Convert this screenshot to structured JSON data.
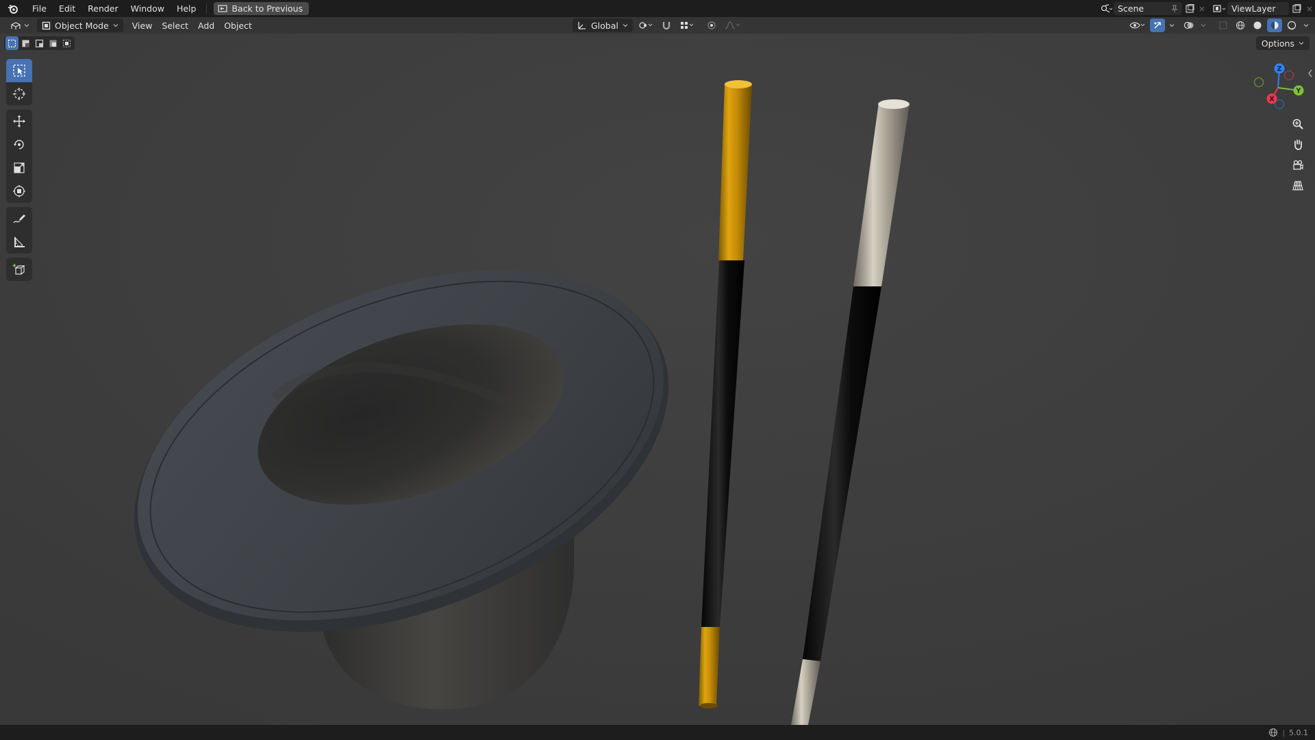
{
  "topbar": {
    "menus": [
      "File",
      "Edit",
      "Render",
      "Window",
      "Help"
    ],
    "back_button": "Back to Previous",
    "scene_name": "Scene",
    "view_layer_name": "ViewLayer"
  },
  "viewport_header": {
    "mode": "Object Mode",
    "menus": [
      "View",
      "Select",
      "Add",
      "Object"
    ],
    "transform_orientation": "Global",
    "options_label": "Options"
  },
  "toolbar": {
    "tools": [
      "select-box",
      "cursor",
      "move",
      "rotate",
      "scale",
      "transform",
      "annotate",
      "measure",
      "add-cube"
    ],
    "active_tool": "select-box"
  },
  "gizmo": {
    "axes": [
      "X",
      "Y",
      "Z"
    ],
    "colors": {
      "x": "#e83a4b",
      "y": "#7fbf3c",
      "z": "#2f83f0"
    }
  },
  "statusbar": {
    "version": "5.0.1"
  },
  "scene": {
    "objects": [
      "top-hat",
      "gold-magic-wand",
      "silver-magic-wand"
    ],
    "background": "#3d3d3d"
  },
  "accent": "#4772b3"
}
